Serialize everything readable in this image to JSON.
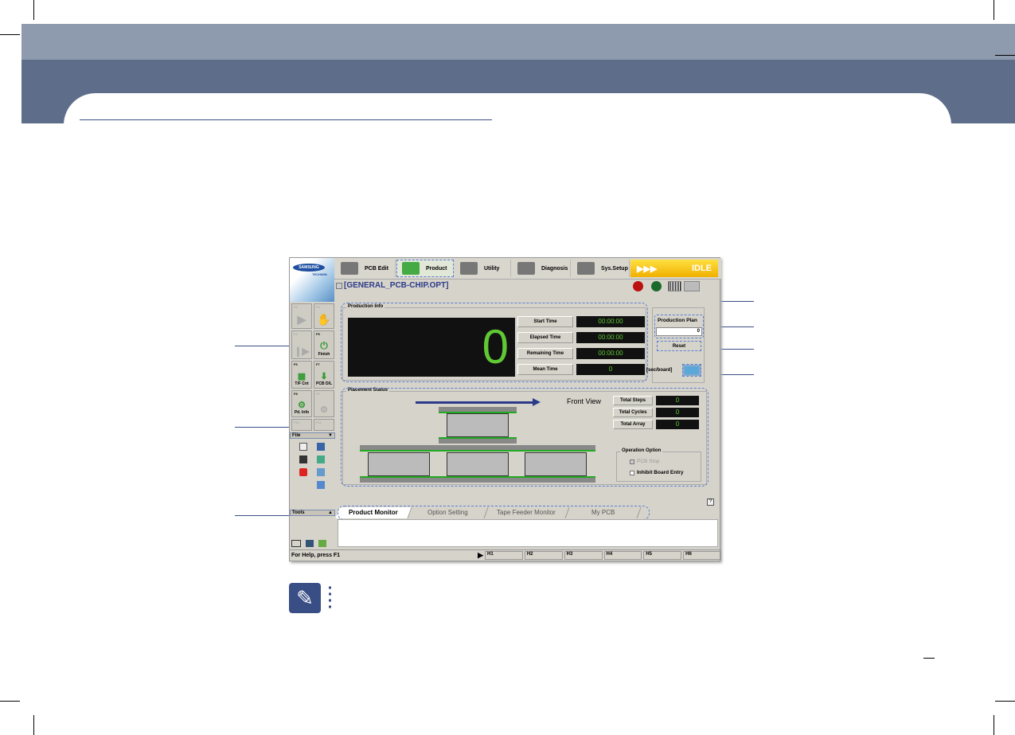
{
  "app": {
    "logo": {
      "brand": "SAMSUNG",
      "sub": "TECHWIN"
    },
    "toolbar": [
      {
        "label": "PCB Edit",
        "icon": "pcb-edit-icon"
      },
      {
        "label": "Product",
        "icon": "product-gear-icon"
      },
      {
        "label": "Utility",
        "icon": "utility-folder-icon"
      },
      {
        "label": "Diagnosis",
        "icon": "diagnosis-icon"
      },
      {
        "label": "Sys.Setup",
        "icon": "sys-setup-icon"
      }
    ],
    "status_indicator": {
      "arrows": "▶▶▶",
      "label": "IDLE"
    },
    "file_title": "[GENERAL_PCB-CHIP.OPT]",
    "function_keys": [
      {
        "key": "F2",
        "label": "",
        "icon": "play-icon",
        "enabled": false
      },
      {
        "key": "F3",
        "label": "",
        "icon": "hand-stop-icon",
        "enabled": false
      },
      {
        "key": "F4",
        "label": "",
        "icon": "step-play-icon",
        "enabled": false
      },
      {
        "key": "F5",
        "label": "Finish",
        "icon": "finish-icon",
        "enabled": true
      },
      {
        "key": "F6",
        "label": "T/F Cnt",
        "icon": "grid-icon",
        "enabled": true
      },
      {
        "key": "F7",
        "label": "PCB D/L",
        "icon": "pcb-download-icon",
        "enabled": true
      },
      {
        "key": "F8",
        "label": "Pd. Info",
        "icon": "gear-list-icon",
        "enabled": true
      },
      {
        "key": "F9",
        "label": "",
        "icon": "gear-pin-icon",
        "enabled": false
      },
      {
        "key": "F10",
        "label": "",
        "icon": "",
        "enabled": false
      },
      {
        "key": "F11",
        "label": "",
        "icon": "",
        "enabled": false
      }
    ],
    "file_panel": {
      "title": "File",
      "tools_title": "Tools"
    },
    "production_info": {
      "title": "Production Info",
      "count": "0",
      "rows": [
        {
          "label": "Start Time",
          "value": "00:00:00"
        },
        {
          "label": "Elapsed Time",
          "value": "00:00:00"
        },
        {
          "label": "Remaining Time",
          "value": "00:00:00"
        },
        {
          "label": "Mean Time",
          "value": "0"
        }
      ]
    },
    "production_plan": {
      "label": "Production Plan",
      "value": "0",
      "reset": "Reset",
      "unit": "[sec/board]"
    },
    "placement": {
      "title": "Placement Status",
      "view": "Front View",
      "rows": [
        {
          "label": "Total Steps",
          "value": "0"
        },
        {
          "label": "Total Cycles",
          "value": "0"
        },
        {
          "label": "Total Array",
          "value": "0"
        }
      ],
      "option_title": "Operation Option",
      "options": [
        {
          "label": "PCB Stop",
          "enabled": false
        },
        {
          "label": "Inhibit Board Entry",
          "enabled": true
        }
      ]
    },
    "help_button": "?",
    "tabs": [
      "Product Monitor",
      "Option Setting",
      "Tape Feeder Monitor",
      "My PCB"
    ],
    "status_bar": {
      "help": "For Help, press F1",
      "heads": [
        "H1",
        "H2",
        "H3",
        "H4",
        "H5",
        "H6"
      ]
    }
  },
  "colors": {
    "band_light": "#8e9aae",
    "band_dark": "#5e6e8a",
    "accent": "#3a4e86",
    "lcd_green": "#5fc834"
  }
}
